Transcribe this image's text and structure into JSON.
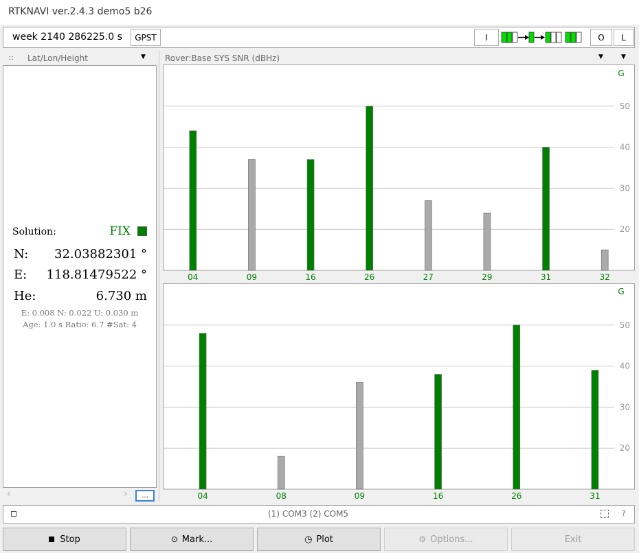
{
  "window": {
    "title": "RTKNAVI ver.2.4.3 demo5 b26"
  },
  "toolbar": {
    "time": "week 2140 286225.0 s",
    "timesys": "GPST",
    "input": "I",
    "output": "O",
    "log": "L"
  },
  "left_panel": {
    "mode": "Lat/Lon/Height",
    "solution_label": "Solution:",
    "solution_status": "FIX",
    "status_color": "#008000",
    "n_label": "N:",
    "n_value": "32.03882301 °",
    "e_label": "E:",
    "e_value": "118.81479522 °",
    "h_label": "He:",
    "h_value": "6.730 m",
    "std_line": "E: 0.008 N: 0.022 U: 0.030 m",
    "age_line": "Age: 1.0 s Ratio: 6.7 #Sat: 4",
    "scroll_button": "..."
  },
  "right_panel": {
    "mode": "Rover:Base SYS SNR (dBHz)"
  },
  "status_bar": {
    "text": "(1) COM3 (2) COM5",
    "help": "?"
  },
  "buttons": {
    "stop": "Stop",
    "mark": "Mark...",
    "plot": "Plot",
    "options": "Options...",
    "exit": "Exit"
  },
  "colors": {
    "used": "#008000",
    "unused": "#aaaaaa",
    "grid": "#c8c8c8",
    "label": "#008000"
  },
  "chart_data": [
    {
      "type": "bar",
      "system": "G",
      "categories": [
        "04",
        "09",
        "16",
        "26",
        "27",
        "29",
        "31",
        "32"
      ],
      "values": [
        44,
        37,
        37,
        50,
        27,
        24,
        40,
        15
      ],
      "used": [
        true,
        false,
        true,
        true,
        false,
        false,
        true,
        false
      ],
      "yticks": [
        20,
        30,
        40,
        50
      ],
      "ylim": [
        10,
        60
      ]
    },
    {
      "type": "bar",
      "system": "G",
      "categories": [
        "04",
        "08",
        "09",
        "16",
        "26",
        "31"
      ],
      "values": [
        48,
        18,
        36,
        38,
        50,
        39
      ],
      "used": [
        true,
        false,
        false,
        true,
        true,
        true
      ],
      "yticks": [
        20,
        30,
        40,
        50
      ],
      "ylim": [
        10,
        60
      ]
    }
  ]
}
